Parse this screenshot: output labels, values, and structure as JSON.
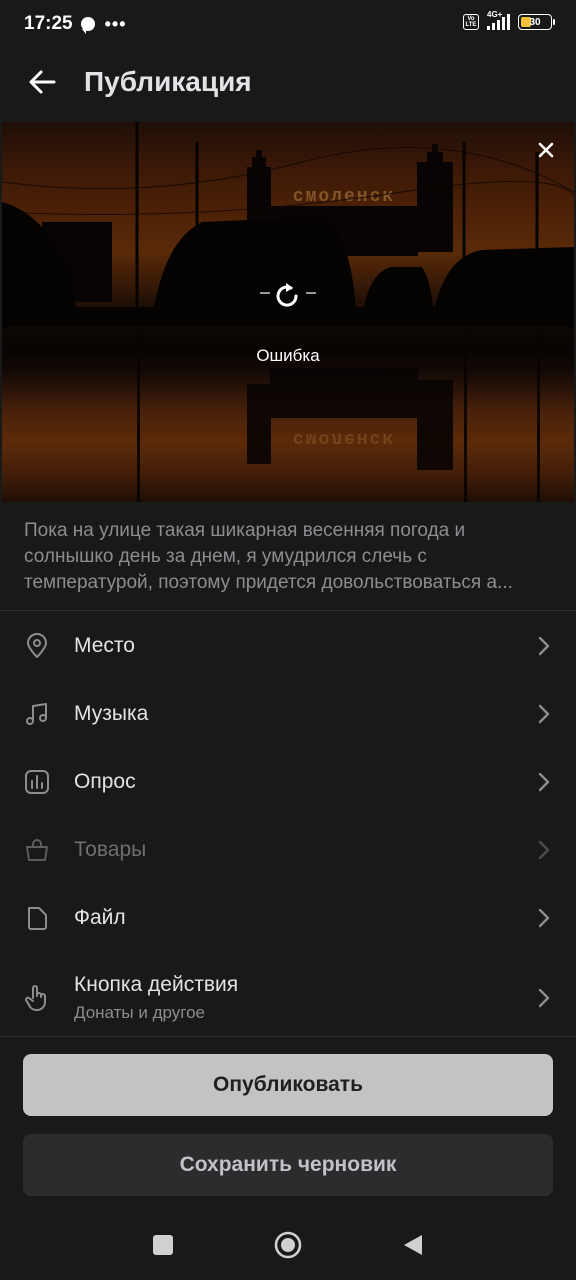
{
  "status_bar": {
    "time": "17:25",
    "more": "•••",
    "volte": "Vo LTE",
    "network": "4G+",
    "battery": "30"
  },
  "header": {
    "title": "Публикация"
  },
  "media": {
    "status": "Ошибка",
    "sign_text": "смоленск"
  },
  "post": {
    "text": "Пока на улице такая шикарная весенняя погода и солнышко день за днем, я умудрился слечь с температурой, поэтому придется довольствоваться а..."
  },
  "menu": {
    "items": [
      {
        "label": "Место",
        "icon": "location-pin-icon"
      },
      {
        "label": "Музыка",
        "icon": "music-note-icon"
      },
      {
        "label": "Опрос",
        "icon": "poll-icon"
      },
      {
        "label": "Товары",
        "icon": "shopping-bag-icon",
        "disabled": true
      },
      {
        "label": "Файл",
        "icon": "file-icon"
      },
      {
        "label": "Кнопка действия",
        "sublabel": "Донаты и другое",
        "icon": "hand-pointer-icon"
      }
    ]
  },
  "actions": {
    "publish": "Опубликовать",
    "save_draft": "Сохранить черновик"
  },
  "colors": {
    "background": "#191919",
    "primary_button": "#c2c3c5",
    "secondary_button": "#2c2c2e",
    "text_primary": "#e1e3e6",
    "text_secondary": "#8b8d91"
  }
}
